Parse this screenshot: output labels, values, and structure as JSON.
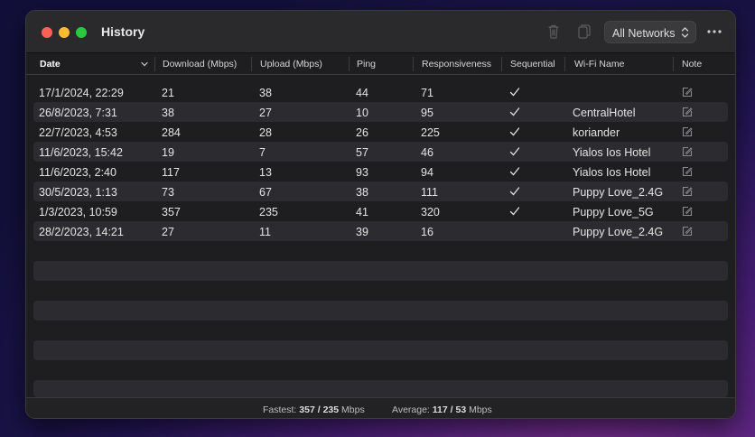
{
  "window": {
    "title": "History"
  },
  "toolbar": {
    "network_filter": "All Networks"
  },
  "table": {
    "sorted_column": "Date",
    "columns": [
      "Date",
      "Download (Mbps)",
      "Upload (Mbps)",
      "Ping",
      "Responsiveness",
      "Sequential",
      "Wi-Fi Name",
      "Note"
    ],
    "rows": [
      {
        "date": "17/1/2024, 22:29",
        "download": "21",
        "upload": "38",
        "ping": "44",
        "responsiveness": "71",
        "sequential": true,
        "wifi": ""
      },
      {
        "date": "26/8/2023, 7:31",
        "download": "38",
        "upload": "27",
        "ping": "10",
        "responsiveness": "95",
        "sequential": true,
        "wifi": "CentralHotel"
      },
      {
        "date": "22/7/2023, 4:53",
        "download": "284",
        "upload": "28",
        "ping": "26",
        "responsiveness": "225",
        "sequential": true,
        "wifi": "koriander"
      },
      {
        "date": "11/6/2023, 15:42",
        "download": "19",
        "upload": "7",
        "ping": "57",
        "responsiveness": "46",
        "sequential": true,
        "wifi": "Yialos Ios Hotel"
      },
      {
        "date": "11/6/2023, 2:40",
        "download": "117",
        "upload": "13",
        "ping": "93",
        "responsiveness": "94",
        "sequential": true,
        "wifi": "Yialos Ios Hotel"
      },
      {
        "date": "30/5/2023, 1:13",
        "download": "73",
        "upload": "67",
        "ping": "38",
        "responsiveness": "111",
        "sequential": true,
        "wifi": "Puppy Love_2.4G"
      },
      {
        "date": "1/3/2023, 10:59",
        "download": "357",
        "upload": "235",
        "ping": "41",
        "responsiveness": "320",
        "sequential": true,
        "wifi": "Puppy Love_5G"
      },
      {
        "date": "28/2/2023, 14:21",
        "download": "27",
        "upload": "11",
        "ping": "39",
        "responsiveness": "16",
        "sequential": false,
        "wifi": "Puppy Love_2.4G"
      }
    ]
  },
  "status": {
    "fastest_label": "Fastest:",
    "fastest_download": "357",
    "fastest_upload": "235",
    "average_label": "Average:",
    "average_download": "117",
    "average_upload": "53",
    "separator": "/",
    "unit": "Mbps"
  },
  "colors": {
    "red": "#fe5f57",
    "yellow": "#febc2e",
    "green": "#28c840"
  },
  "icons": [
    "trash-icon",
    "copy-icon",
    "updown-chevron-icon",
    "more-icon",
    "sort-chevron-icon",
    "checkmark-icon",
    "note-edit-icon"
  ]
}
